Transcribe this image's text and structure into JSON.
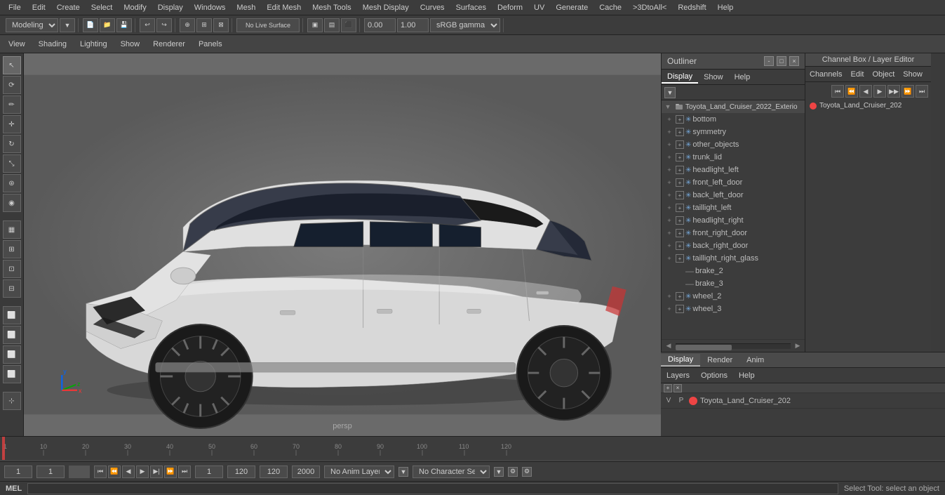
{
  "menubar": {
    "items": [
      "File",
      "Edit",
      "Create",
      "Select",
      "Modify",
      "Display",
      "Windows",
      "Mesh",
      "Edit Mesh",
      "Mesh Tools",
      "Mesh Display",
      "Curves",
      "Surfaces",
      "Deform",
      "UV",
      "Generate",
      "Cache",
      ">3DtoAll<",
      "Redshift",
      "Help"
    ]
  },
  "toolbar": {
    "workspace": "Modeling",
    "color_profile": "sRGB gamma",
    "value1": "0.00",
    "value2": "1.00"
  },
  "viewport_menu": {
    "items": [
      "View",
      "Shading",
      "Lighting",
      "Show",
      "Renderer",
      "Panels"
    ]
  },
  "viewport": {
    "label": "persp"
  },
  "outliner": {
    "title": "Outliner",
    "tabs": [
      "Display",
      "Show",
      "Help"
    ],
    "root": "Toyota_Land_Cruiser_2022_Exterio",
    "items": [
      {
        "label": "bottom",
        "type": "star",
        "has_expand": true
      },
      {
        "label": "symmetry",
        "type": "star",
        "has_expand": true
      },
      {
        "label": "other_objects",
        "type": "star",
        "has_expand": true
      },
      {
        "label": "trunk_lid",
        "type": "star",
        "has_expand": true
      },
      {
        "label": "headlight_left",
        "type": "star",
        "has_expand": true
      },
      {
        "label": "front_left_door",
        "type": "star",
        "has_expand": true
      },
      {
        "label": "back_left_door",
        "type": "star",
        "has_expand": true
      },
      {
        "label": "taillight_left",
        "type": "star",
        "has_expand": true
      },
      {
        "label": "headlight_right",
        "type": "star",
        "has_expand": true
      },
      {
        "label": "front_right_door",
        "type": "star",
        "has_expand": true
      },
      {
        "label": "back_right_door",
        "type": "star",
        "has_expand": true
      },
      {
        "label": "taillight_right_glass",
        "type": "star",
        "has_expand": true
      },
      {
        "label": "brake_2",
        "type": "dash",
        "has_expand": false
      },
      {
        "label": "brake_3",
        "type": "dash",
        "has_expand": false
      },
      {
        "label": "wheel_2",
        "type": "star",
        "has_expand": true
      },
      {
        "label": "wheel_3",
        "type": "star",
        "has_expand": true
      }
    ]
  },
  "channel_box": {
    "title": "Channel Box / Layer Editor",
    "menu_items": [
      "Channels",
      "Edit",
      "Object",
      "Show"
    ],
    "layer_entry": "Toyota_Land_Cruiser_202",
    "bottom_tabs": [
      "Display",
      "Render",
      "Anim"
    ],
    "bottom_menu": [
      "Layers",
      "Options",
      "Help"
    ],
    "layer_row": {
      "v": "V",
      "p": "P",
      "color": "#e44",
      "name": "Toyota_Land_Cruiser_202"
    }
  },
  "timeline": {
    "start": 1,
    "end": 120,
    "current": 1,
    "range_start": 1,
    "range_end": 120,
    "ticks": [
      "1",
      "10",
      "20",
      "30",
      "40",
      "50",
      "60",
      "70",
      "80",
      "90",
      "100",
      "110",
      "120"
    ],
    "tick_positions": [
      0,
      60,
      120,
      180,
      240,
      300,
      360,
      420,
      480,
      540,
      600,
      660,
      720
    ]
  },
  "bottom_controls": {
    "current_frame": "1",
    "current_frame2": "1",
    "range_start": "1",
    "range_end": "120",
    "end_value": "120",
    "end_max": "2000",
    "anim_layer": "No Anim Layer",
    "char_set": "No Character Set"
  },
  "status_bar": {
    "mel_label": "MEL",
    "status_text": "Select Tool: select an object"
  },
  "tools": [
    "select",
    "lasso",
    "paint",
    "move",
    "rotate",
    "scale",
    "universal",
    "soft-select",
    "measure",
    "grid-display",
    "grid-options",
    "outliner-toggle",
    "attr-editor",
    "tool-settings",
    "channel-box-btn",
    "layer-editor"
  ]
}
